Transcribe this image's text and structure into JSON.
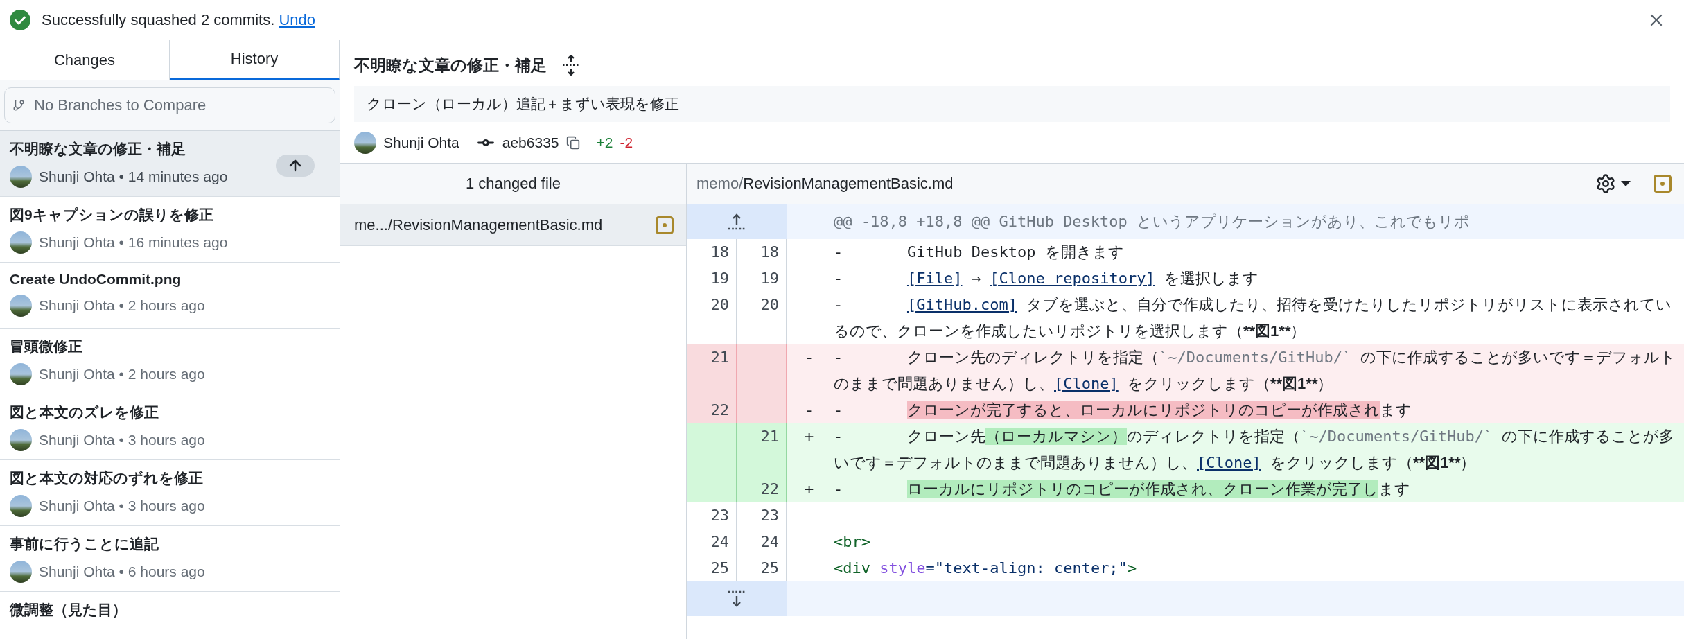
{
  "banner": {
    "message": "Successfully squashed 2 commits.",
    "link": "Undo"
  },
  "tabs": [
    {
      "label": "Changes",
      "selected": false
    },
    {
      "label": "History",
      "selected": true
    }
  ],
  "branch_filter": {
    "placeholder": "No Branches to Compare"
  },
  "commits": [
    {
      "title": "不明瞭な文章の修正・補足",
      "meta": "Shunji Ohta • 14 minutes ago",
      "selected": true,
      "unpushed": true
    },
    {
      "title": "図9キャプションの誤りを修正",
      "meta": "Shunji Ohta • 16 minutes ago",
      "selected": false,
      "unpushed": false
    },
    {
      "title": "Create UndoCommit.png",
      "meta": "Shunji Ohta • 2 hours ago",
      "selected": false,
      "unpushed": false
    },
    {
      "title": "冒頭微修正",
      "meta": "Shunji Ohta • 2 hours ago",
      "selected": false,
      "unpushed": false
    },
    {
      "title": "図と本文のズレを修正",
      "meta": "Shunji Ohta • 3 hours ago",
      "selected": false,
      "unpushed": false
    },
    {
      "title": "図と本文の対応のずれを修正",
      "meta": "Shunji Ohta • 3 hours ago",
      "selected": false,
      "unpushed": false
    },
    {
      "title": "事前に行うことに追記",
      "meta": "Shunji Ohta • 6 hours ago",
      "selected": false,
      "unpushed": false
    },
    {
      "title": "微調整（見た目）",
      "selected": false,
      "unpushed": false
    }
  ],
  "commit_detail": {
    "title": "不明瞭な文章の修正・補足",
    "description": "クローン（ローカル）追記＋まずい表現を修正",
    "author": "Shunji Ohta",
    "sha": "aeb6335",
    "additions": "+2",
    "deletions": "-2"
  },
  "files": {
    "header": "1 changed file",
    "items": [
      {
        "path": "me.../RevisionManagementBasic.md",
        "selected": true
      }
    ]
  },
  "diff": {
    "path_dir": "memo/",
    "path_file": "RevisionManagementBasic.md",
    "lines": [
      {
        "kind": "hunk",
        "segments": [
          {
            "kind": "text",
            "text": "@@ -18,8 +18,8 @@ GitHub Desktop というアプリケーションがあり、これでもリポ"
          }
        ]
      },
      {
        "kind": "context",
        "old": "18",
        "new": "18",
        "segments": [
          {
            "kind": "text",
            "text": "-       GitHub Desktop を開きます"
          }
        ]
      },
      {
        "kind": "context",
        "old": "19",
        "new": "19",
        "segments": [
          {
            "kind": "text",
            "text": "-       "
          },
          {
            "kind": "link",
            "text": "[File]"
          },
          {
            "kind": "text",
            "text": " → "
          },
          {
            "kind": "link",
            "text": "[Clone repository]"
          },
          {
            "kind": "text",
            "text": " を選択します"
          }
        ]
      },
      {
        "kind": "context",
        "old": "20",
        "new": "20",
        "segments": [
          {
            "kind": "text",
            "text": "-       "
          },
          {
            "kind": "link",
            "text": "[GitHub.com]"
          },
          {
            "kind": "text",
            "text": " タブを選ぶと、自分で作成したり、招待を受けたりしたリポジトリがリストに表示されているので、クローンを作成したいリポジトリを選択します（"
          },
          {
            "kind": "bold",
            "text": "**図1**"
          },
          {
            "kind": "text",
            "text": "）"
          }
        ]
      },
      {
        "kind": "deleted",
        "old": "21",
        "marker": "-",
        "segments": [
          {
            "kind": "text",
            "text": "-       クローン先のディレクトリを指定（"
          },
          {
            "kind": "code",
            "text": "`~/Documents/GitHub/`"
          },
          {
            "kind": "text",
            "text": " の下に作成することが多いです＝デフォルトのままで問題ありません）し、"
          },
          {
            "kind": "link",
            "text": "[Clone]"
          },
          {
            "kind": "text",
            "text": " をクリックします（"
          },
          {
            "kind": "bold",
            "text": "**図1**"
          },
          {
            "kind": "text",
            "text": "）"
          }
        ]
      },
      {
        "kind": "deleted",
        "old": "22",
        "marker": "-",
        "segments": [
          {
            "kind": "text",
            "text": "-       "
          },
          {
            "kind": "highlight",
            "text": "クローンが完了すると、ローカルにリポジトリのコピーが作成され"
          },
          {
            "kind": "text",
            "text": "ます"
          }
        ]
      },
      {
        "kind": "added",
        "new": "21",
        "marker": "+",
        "segments": [
          {
            "kind": "text",
            "text": "-       クローン先"
          },
          {
            "kind": "highlight",
            "text": "（ローカルマシン）"
          },
          {
            "kind": "text",
            "text": "のディレクトリを指定（"
          },
          {
            "kind": "code",
            "text": "`~/Documents/GitHub/`"
          },
          {
            "kind": "text",
            "text": " の下に作成することが多いです＝デフォルトのままで問題ありません）し、"
          },
          {
            "kind": "link",
            "text": "[Clone]"
          },
          {
            "kind": "text",
            "text": " をクリックします（"
          },
          {
            "kind": "bold",
            "text": "**図1**"
          },
          {
            "kind": "text",
            "text": "）"
          }
        ]
      },
      {
        "kind": "added",
        "new": "22",
        "marker": "+",
        "segments": [
          {
            "kind": "text",
            "text": "-       "
          },
          {
            "kind": "highlight",
            "text": "ローカルにリポジトリのコピーが作成され、クローン作業が完了し"
          },
          {
            "kind": "text",
            "text": "ます"
          }
        ]
      },
      {
        "kind": "context",
        "old": "23",
        "new": "23"
      },
      {
        "kind": "context",
        "old": "24",
        "new": "24",
        "segments": [
          {
            "kind": "tag",
            "text": "<br>"
          }
        ]
      },
      {
        "kind": "context",
        "old": "25",
        "new": "25",
        "segments": [
          {
            "kind": "tag",
            "text": "<div"
          },
          {
            "kind": "attr",
            "text": " style"
          },
          {
            "kind": "string",
            "text": "=\"text-align: center;\""
          },
          {
            "kind": "tag",
            "text": ">"
          }
        ]
      },
      {
        "kind": "expand"
      }
    ]
  }
}
